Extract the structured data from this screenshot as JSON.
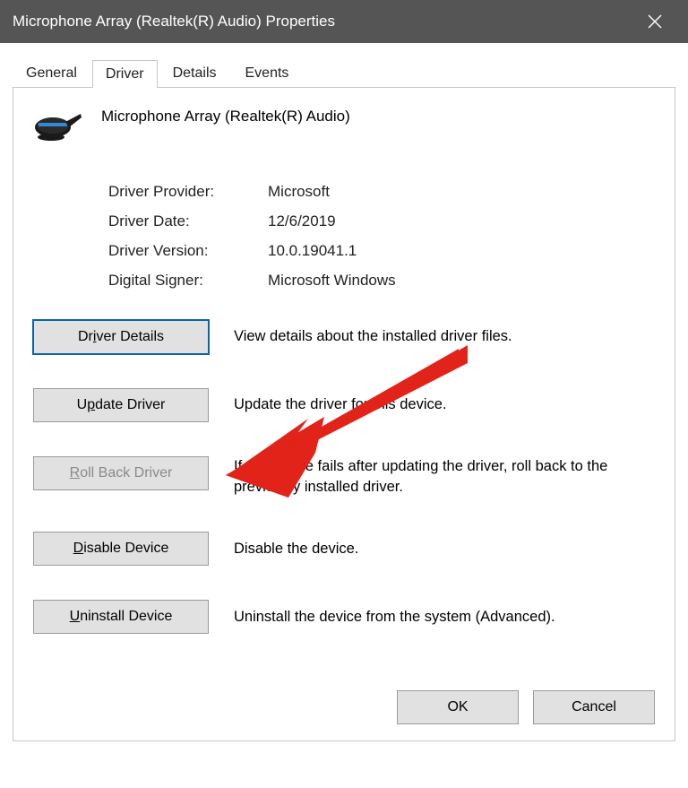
{
  "titlebar": {
    "title": "Microphone Array (Realtek(R) Audio) Properties"
  },
  "tabs": {
    "general": "General",
    "driver": "Driver",
    "details": "Details",
    "events": "Events"
  },
  "device": {
    "name": "Microphone Array (Realtek(R) Audio)"
  },
  "info": {
    "provider_label": "Driver Provider:",
    "provider_value": "Microsoft",
    "date_label": "Driver Date:",
    "date_value": "12/6/2019",
    "version_label": "Driver Version:",
    "version_value": "10.0.19041.1",
    "signer_label": "Digital Signer:",
    "signer_value": "Microsoft Windows"
  },
  "actions": {
    "details_btn_pre": "Dr",
    "details_btn_u": "i",
    "details_btn_post": "ver Details",
    "details_desc": "View details about the installed driver files.",
    "update_btn_pre": "U",
    "update_btn_u": "p",
    "update_btn_post": "date Driver",
    "update_desc": "Update the driver for this device.",
    "rollback_btn_pre": "",
    "rollback_btn_u": "R",
    "rollback_btn_post": "oll Back Driver",
    "rollback_desc": "If the device fails after updating the driver, roll back to the previously installed driver.",
    "disable_btn_pre": "",
    "disable_btn_u": "D",
    "disable_btn_post": "isable Device",
    "disable_desc": "Disable the device.",
    "uninstall_btn_pre": "",
    "uninstall_btn_u": "U",
    "uninstall_btn_post": "ninstall Device",
    "uninstall_desc": "Uninstall the device from the system (Advanced)."
  },
  "footer": {
    "ok": "OK",
    "cancel": "Cancel"
  }
}
